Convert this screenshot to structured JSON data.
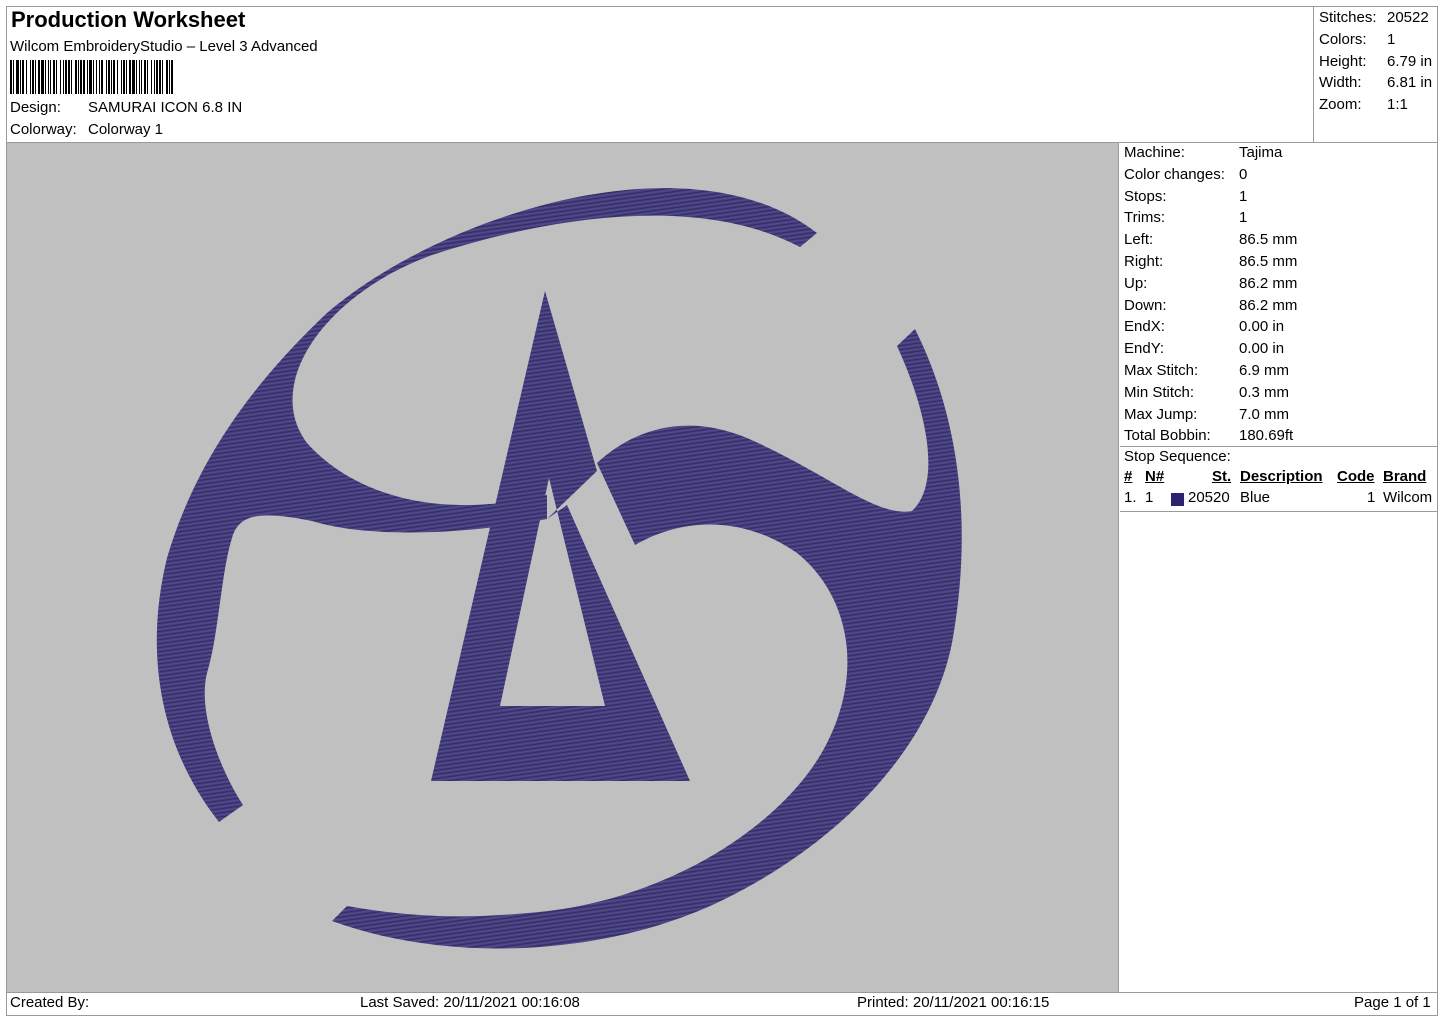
{
  "header": {
    "title": "Production Worksheet",
    "subtitle": "Wilcom EmbroideryStudio – Level 3 Advanced",
    "design_label": "Design:",
    "design_value": "SAMURAI ICON 6.8 IN",
    "colorway_label": "Colorway:",
    "colorway_value": "Colorway 1"
  },
  "stats": {
    "stitches_label": "Stitches:",
    "stitches": "20522",
    "colors_label": "Colors:",
    "colors": "1",
    "height_label": "Height:",
    "height": "6.79 in",
    "width_label": "Width:",
    "width": "6.81 in",
    "zoom_label": "Zoom:",
    "zoom": "1:1"
  },
  "info": [
    {
      "label": "Machine:",
      "value": "Tajima"
    },
    {
      "label": "Color changes:",
      "value": "0"
    },
    {
      "label": "Stops:",
      "value": "1"
    },
    {
      "label": "Trims:",
      "value": "1"
    },
    {
      "label": "Left:",
      "value": "86.5 mm"
    },
    {
      "label": "Right:",
      "value": "86.5 mm"
    },
    {
      "label": "Up:",
      "value": "86.2 mm"
    },
    {
      "label": "Down:",
      "value": "86.2 mm"
    },
    {
      "label": "EndX:",
      "value": "0.00 in"
    },
    {
      "label": "EndY:",
      "value": "0.00 in"
    },
    {
      "label": "Max Stitch:",
      "value": "6.9 mm"
    },
    {
      "label": "Min Stitch:",
      "value": "0.3 mm"
    },
    {
      "label": "Max Jump:",
      "value": "7.0 mm"
    },
    {
      "label": "Total Bobbin:",
      "value": "180.69ft"
    }
  ],
  "stop_sequence": {
    "title": "Stop Sequence:",
    "columns": {
      "num": "#",
      "needle": "N#",
      "stitches": "St.",
      "description": "Description",
      "code": "Code",
      "brand": "Brand"
    },
    "rows": [
      {
        "num": "1.",
        "needle": "1",
        "stitches": "20520",
        "description": "Blue",
        "code": "1",
        "brand": "Wilcom",
        "color": "#2b2270"
      }
    ]
  },
  "design": {
    "thread_color": "#463f7e",
    "background_color": "#c0c0c0"
  },
  "footer": {
    "created_by": "Created By:",
    "last_saved": "Last Saved: 20/11/2021 00:16:08",
    "printed": "Printed: 20/11/2021 00:16:15",
    "page": "Page 1 of 1"
  }
}
